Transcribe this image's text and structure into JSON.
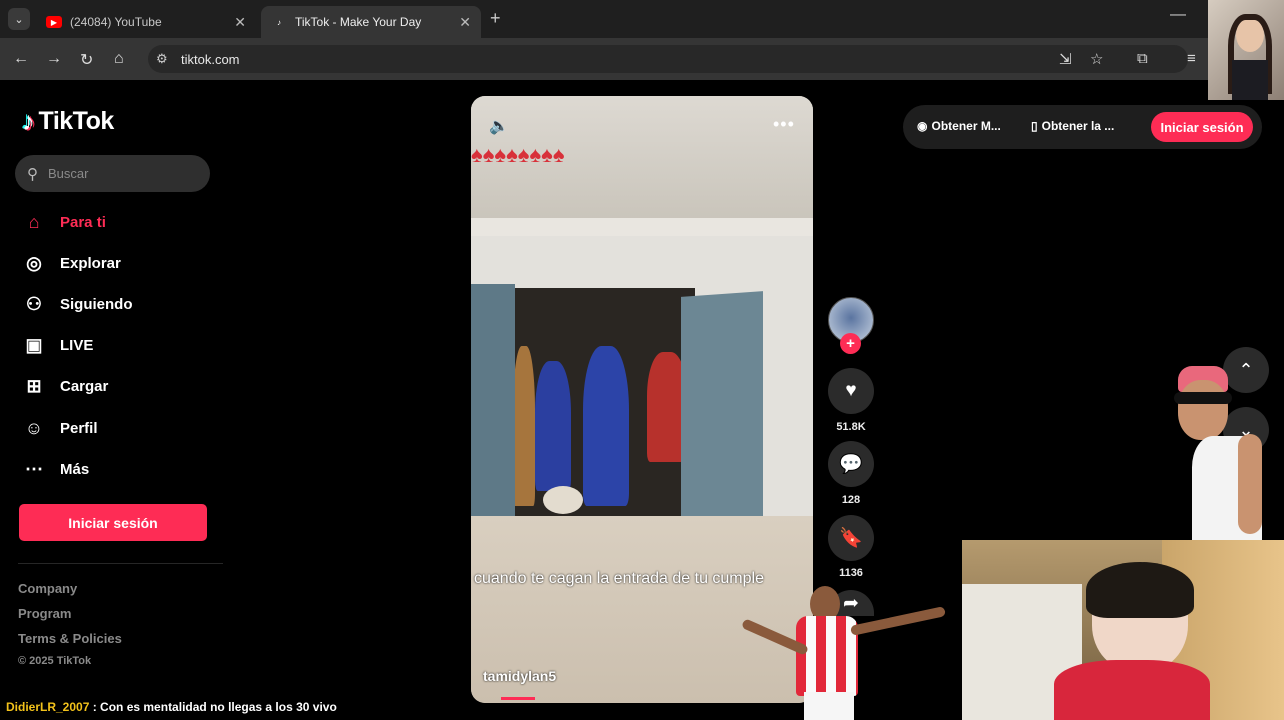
{
  "browser": {
    "tabs": [
      {
        "title": "(24084) YouTube",
        "active": false,
        "favicon": "youtube-icon"
      },
      {
        "title": "TikTok - Make Your Day",
        "active": true,
        "favicon": "tiktok-icon"
      }
    ],
    "url": "tiktok.com"
  },
  "tiktok": {
    "logo": "TikTok",
    "search_placeholder": "Buscar",
    "nav": [
      {
        "label": "Para ti",
        "icon": "home-icon",
        "active": true
      },
      {
        "label": "Explorar",
        "icon": "compass-icon",
        "active": false
      },
      {
        "label": "Siguiendo",
        "icon": "following-icon",
        "active": false
      },
      {
        "label": "LIVE",
        "icon": "live-tv-icon",
        "active": false
      },
      {
        "label": "Cargar",
        "icon": "upload-icon",
        "active": false
      },
      {
        "label": "Perfil",
        "icon": "profile-icon",
        "active": false
      },
      {
        "label": "Más",
        "icon": "more-dots-icon",
        "active": false
      }
    ],
    "sidebar_login": "Iniciar sesión",
    "footer": [
      "Company",
      "Program",
      "Terms & Policies"
    ],
    "copyright": "© 2025 TikTok",
    "top_links": [
      "Obtener M...",
      "Obtener la ..."
    ],
    "top_login": "Iniciar sesión",
    "accent_color": "#fe2c55"
  },
  "video": {
    "caption": "cuando te cagan la entrada de tu cumple",
    "author": "tamidylan5",
    "likes": "51.8K",
    "comments": "128",
    "saves": "1136",
    "progress_fraction": 0.1
  },
  "stream": {
    "chat_user": "DidierLR_2007",
    "chat_message": ": Con es mentalidad no llegas a los 30 vivo"
  }
}
